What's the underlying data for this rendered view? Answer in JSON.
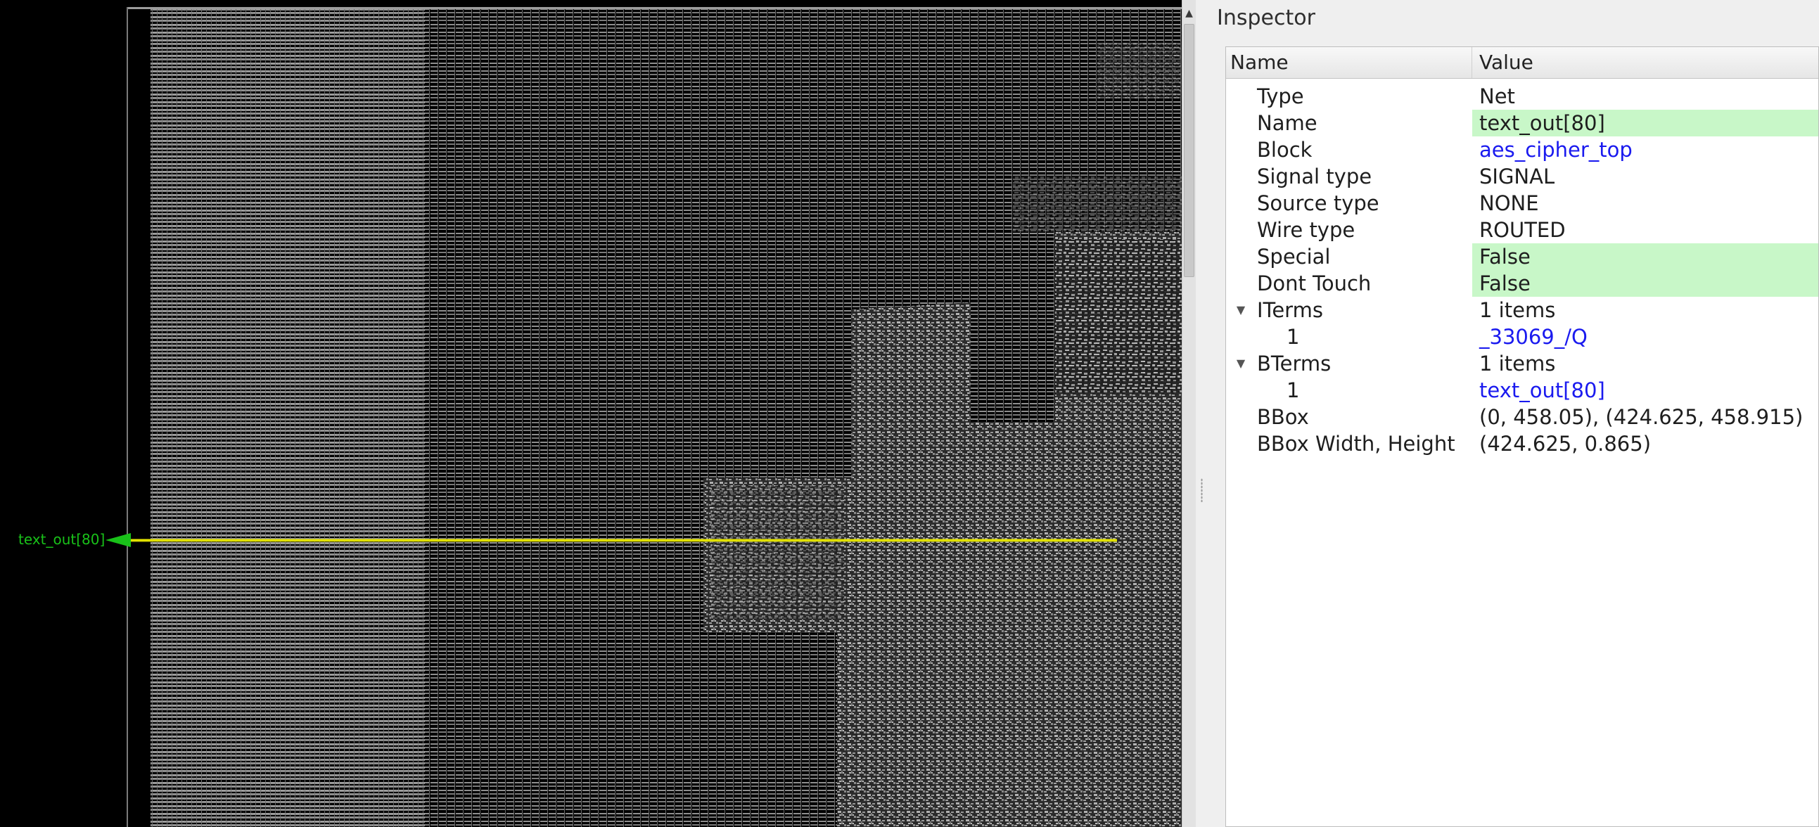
{
  "layout_view": {
    "pin_label": "text_out[80]",
    "colors": {
      "background": "#000000",
      "rows": "#8c8c8c",
      "highlight_net": "#e8e800",
      "pin": "#19c119"
    }
  },
  "inspector": {
    "title": "Inspector",
    "columns": {
      "name": "Name",
      "value": "Value"
    },
    "rows": [
      {
        "name": "Type",
        "value": "Net"
      },
      {
        "name": "Name",
        "value": "text_out[80]"
      },
      {
        "name": "Block",
        "value": "aes_cipher_top"
      },
      {
        "name": "Signal type",
        "value": "SIGNAL"
      },
      {
        "name": "Source type",
        "value": "NONE"
      },
      {
        "name": "Wire type",
        "value": "ROUTED"
      },
      {
        "name": "Special",
        "value": "False"
      },
      {
        "name": "Dont Touch",
        "value": "False"
      },
      {
        "name": "ITerms",
        "value": "1 items"
      },
      {
        "name": "1",
        "value": "_33069_/Q"
      },
      {
        "name": "BTerms",
        "value": "1 items"
      },
      {
        "name": "1",
        "value": "text_out[80]"
      },
      {
        "name": "BBox",
        "value": "(0, 458.05), (424.625, 458.915)"
      },
      {
        "name": "BBox Width, Height",
        "value": "(424.625, 0.865)"
      }
    ],
    "colors": {
      "editable_highlight": "#c8f7c8",
      "link": "#1a1aef"
    },
    "icons": {
      "expanded": "triangle-down-icon",
      "scroll_up": "arrow-up-icon"
    }
  }
}
